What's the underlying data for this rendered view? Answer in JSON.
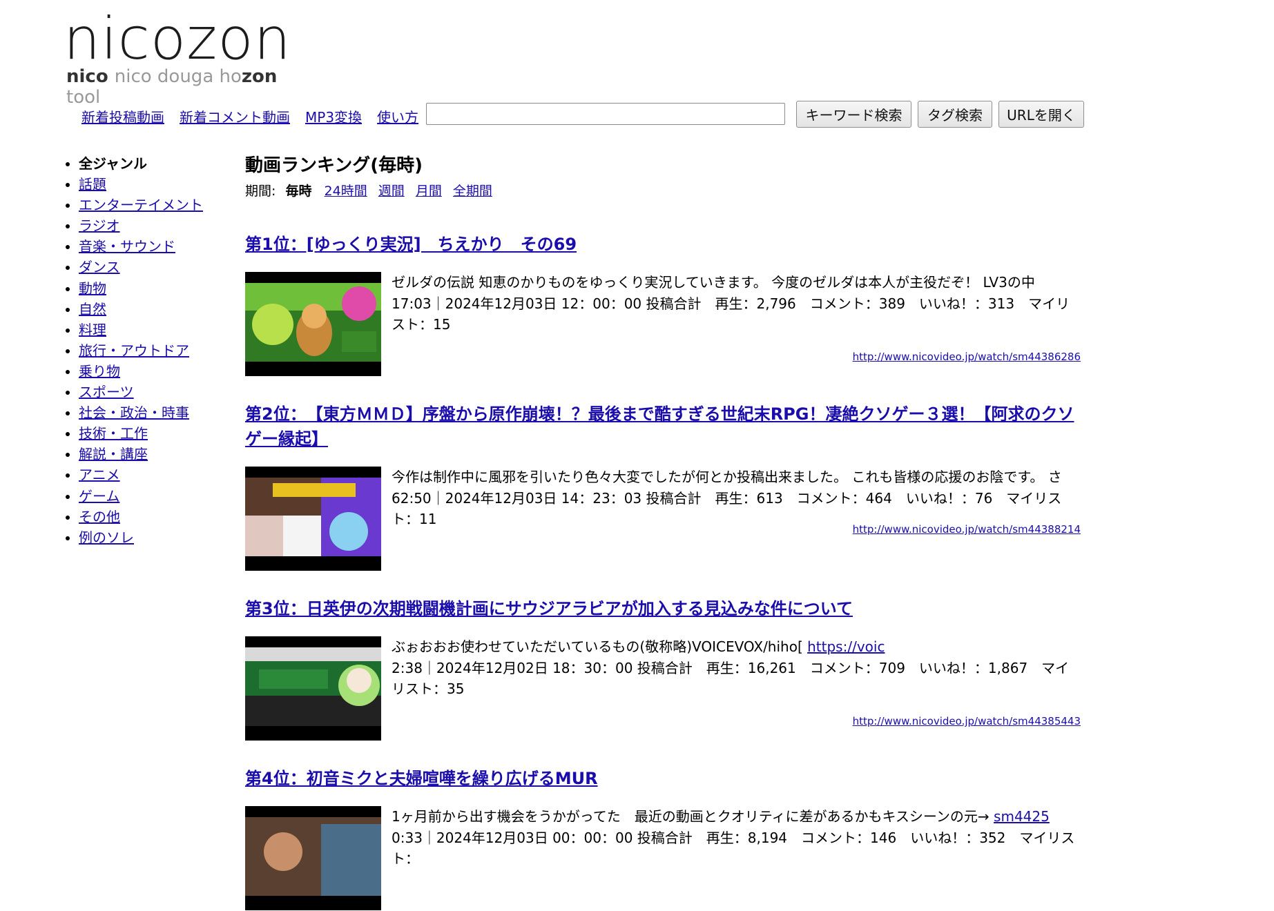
{
  "logo": {
    "main": "nicozon",
    "sub_parts": [
      {
        "t": "nico ",
        "dark": true
      },
      {
        "t": "nico douga ",
        "dark": false
      },
      {
        "t": "ho",
        "dark": false
      },
      {
        "t": "zon",
        "dark": true
      },
      {
        "t": " tool",
        "dark": false
      }
    ]
  },
  "nav": {
    "links": [
      "新着投稿動画",
      "新着コメント動画",
      "MP3変換",
      "使い方"
    ],
    "search_value": "",
    "buttons": [
      "キーワード検索",
      "タグ検索",
      "URLを開く"
    ]
  },
  "sidebar": {
    "items": [
      {
        "label": "全ジャンル",
        "current": true
      },
      {
        "label": "話題"
      },
      {
        "label": "エンターテイメント"
      },
      {
        "label": "ラジオ"
      },
      {
        "label": "音楽・サウンド"
      },
      {
        "label": "ダンス"
      },
      {
        "label": "動物"
      },
      {
        "label": "自然"
      },
      {
        "label": "料理"
      },
      {
        "label": "旅行・アウトドア"
      },
      {
        "label": "乗り物"
      },
      {
        "label": "スポーツ"
      },
      {
        "label": "社会・政治・時事"
      },
      {
        "label": "技術・工作"
      },
      {
        "label": "解説・講座"
      },
      {
        "label": "アニメ"
      },
      {
        "label": "ゲーム"
      },
      {
        "label": "その他"
      },
      {
        "label": "例のソレ"
      }
    ]
  },
  "main": {
    "heading": "動画ランキング(毎時)",
    "period_label": "期間:",
    "period_current": "毎時",
    "period_links": [
      "24時間",
      "週間",
      "月間",
      "全期間"
    ],
    "entries": [
      {
        "title": "第1位：[ゆっくり実況]　ちえかり　その69",
        "desc": "ゼルダの伝説 知恵のかりものをゆっくり実況していきます。 今度のゼルダは本人が主役だぞ！ LV3の中",
        "stats": "17:03｜2024年12月03日 12：00：00 投稿合計　再生：2,796　コメント：389　いいね！：313　マイリスト：15",
        "url": "http://www.nicovideo.jp/watch/sm44386286",
        "thumb_colors": [
          "#2a6e1a",
          "#9bd23a",
          "#e04aa8"
        ]
      },
      {
        "title": "第2位：　【東方ＭＭＤ】序盤から原作崩壊！？最後まで酷すぎる世紀末RPG！凄絶クソゲー３選！【阿求のクソゲー縁起】",
        "desc": "今作は制作中に風邪を引いたり色々大変でしたが何とか投稿出来ました。 これも皆様の応援のお陰です。 さ",
        "stats": "62:50｜2024年12月03日 14：23：03 投稿合計　再生：613　コメント：464　いいね！：76　マイリスト：11",
        "url": "http://www.nicovideo.jp/watch/sm44388214",
        "thumb_colors": [
          "#3a1a6e",
          "#d4b028",
          "#7a4ad8"
        ]
      },
      {
        "title": "第3位：日英伊の次期戦闘機計画にサウジアラビアが加入する見込みな件について",
        "desc": "ぶぉおおお使わせていただいているもの(敬称略)VOICEVOX/hiho[",
        "desc_link": "https://voic",
        "stats": "2:38｜2024年12月02日 18：30：00 投稿合計　再生：16,261　コメント：709　いいね！：1,867　マイリスト：35",
        "url": "http://www.nicovideo.jp/watch/sm44385443",
        "thumb_colors": [
          "#1c6b2c",
          "#ffffff",
          "#9ad06a"
        ]
      },
      {
        "title": "第4位：初音ミクと夫婦喧嘩を繰り広げるMUR",
        "desc": "1ヶ月前から出す機会をうかがってた　最近の動画とクオリティに差があるかもキスシーンの元→ ",
        "desc_link": "sm4425",
        "stats": "0:33｜2024年12月03日 00：00：00 投稿合計　再生：8,194　コメント：146　いいね！：352　マイリスト：",
        "url": "",
        "thumb_colors": [
          "#6b4a2c",
          "#d9a070",
          "#4a6e8a"
        ]
      }
    ]
  }
}
